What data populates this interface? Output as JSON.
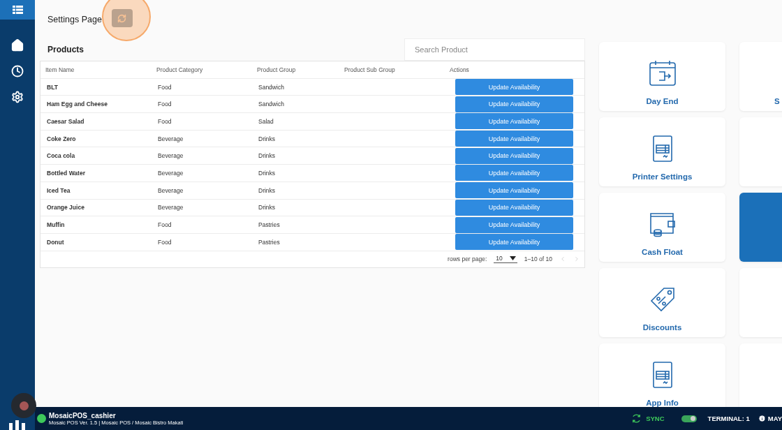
{
  "header": {
    "title": "Settings Page"
  },
  "products": {
    "title": "Products",
    "search": {
      "placeholder": "Search Product"
    },
    "columns": [
      "Item Name",
      "Product Category",
      "Product Group",
      "Product Sub Group",
      "Actions"
    ],
    "rows": [
      {
        "item": "BLT",
        "category": "Food",
        "group": "Sandwich",
        "action": "Update Availability"
      },
      {
        "item": "Ham Egg and Cheese",
        "category": "Food",
        "group": "Sandwich",
        "action": "Update Availability"
      },
      {
        "item": "Caesar Salad",
        "category": "Food",
        "group": "Salad",
        "action": "Update Availability"
      },
      {
        "item": "Coke Zero",
        "category": "Beverage",
        "group": "Drinks",
        "action": "Update Availability"
      },
      {
        "item": "Coca cola",
        "category": "Beverage",
        "group": "Drinks",
        "action": "Update Availability"
      },
      {
        "item": "Bottled Water",
        "category": "Beverage",
        "group": "Drinks",
        "action": "Update Availability"
      },
      {
        "item": "Iced Tea",
        "category": "Beverage",
        "group": "Drinks",
        "action": "Update Availability"
      },
      {
        "item": "Orange Juice",
        "category": "Beverage",
        "group": "Drinks",
        "action": "Update Availability"
      },
      {
        "item": "Muffin",
        "category": "Food",
        "group": "Pastries",
        "action": "Update Availability"
      },
      {
        "item": "Donut",
        "category": "Food",
        "group": "Pastries",
        "action": "Update Availability"
      }
    ],
    "pagination": {
      "label": "rows per page:",
      "rows_per_page": "10",
      "range": "1–10 of 10"
    }
  },
  "tiles": [
    {
      "kind": "day-end",
      "label": "Day End",
      "highlighted": false
    },
    {
      "kind": "blank",
      "label": "S",
      "highlighted": false
    },
    {
      "kind": "printer",
      "label": "Printer Settings",
      "highlighted": false
    },
    {
      "kind": "blank",
      "highlighted": false
    },
    {
      "kind": "cash",
      "label": "Cash Float",
      "highlighted": false
    },
    {
      "kind": "blank",
      "highlighted": true
    },
    {
      "kind": "discount",
      "label": "Discounts",
      "highlighted": false
    },
    {
      "kind": "blank",
      "highlighted": false
    },
    {
      "kind": "info",
      "label": "App Info",
      "highlighted": false
    },
    {
      "kind": "blank",
      "highlighted": false
    }
  ],
  "status_bar": {
    "user": "MosaicPOS_cashier",
    "online": true,
    "details": "Mosaic POS Ver. 1.5 | Mosaic POS / Mosaic Bistro Makati",
    "sync": "SYNC",
    "toggle_on": true,
    "terminal": "TERMINAL: 1",
    "notice": "MAY"
  }
}
